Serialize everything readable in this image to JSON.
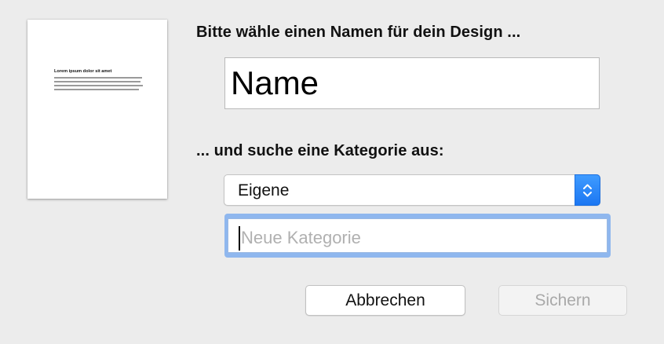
{
  "preview": {
    "title": "Lorem ipsum dolor sit amet"
  },
  "dialog": {
    "name_heading": "Bitte wähle einen Namen für dein Design ...",
    "name_value": "Name",
    "category_heading": "... und suche eine Kategorie aus:",
    "category_selected": "Eigene",
    "new_category_placeholder": "Neue Kategorie",
    "cancel_label": "Abbrechen",
    "save_label": "Sichern"
  },
  "icons": {
    "stepper": "chevron-up-down-icon"
  },
  "colors": {
    "accent": "#1c77f2",
    "focus_ring": "#8fb7ee",
    "background": "#ececec"
  }
}
